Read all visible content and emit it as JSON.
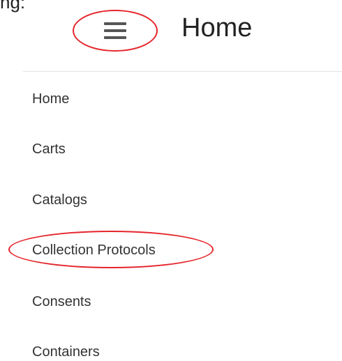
{
  "header": {
    "cut_off_text": "ng:",
    "menu_icon": "hamburger-menu-icon",
    "title": "Home"
  },
  "annotation": {
    "color": "#e5252b"
  },
  "sidebar": {
    "items": [
      {
        "label": "Home"
      },
      {
        "label": "Carts"
      },
      {
        "label": "Catalogs"
      },
      {
        "label": "Collection Protocols",
        "highlighted": true
      },
      {
        "label": "Consents"
      },
      {
        "label": "Containers"
      }
    ]
  }
}
